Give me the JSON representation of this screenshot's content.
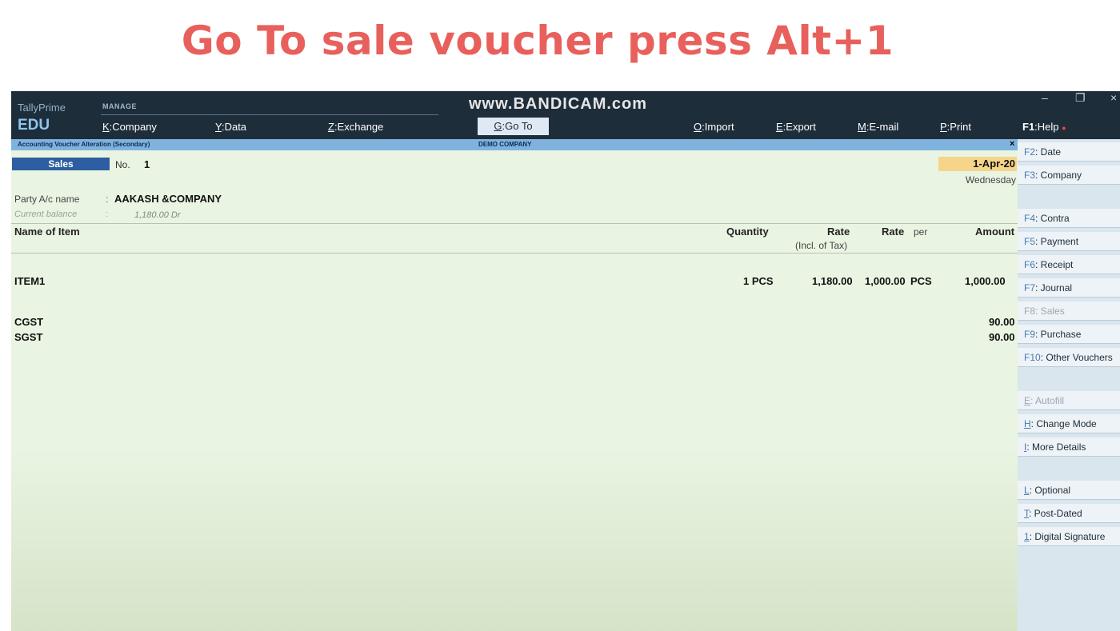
{
  "caption": "Go To sale voucher press Alt+1",
  "app": {
    "product": "TallyPrime",
    "edition": "EDU",
    "manage_label": "MANAGE",
    "watermark": "www.BANDICAM.com",
    "menu": [
      {
        "key": "K",
        "label": ":Company"
      },
      {
        "key": "Y",
        "label": ":Data"
      },
      {
        "key": "Z",
        "label": ":Exchange"
      },
      {
        "key": "G",
        "label": ":Go To"
      },
      {
        "key": "O",
        "label": ":Import"
      },
      {
        "key": "E",
        "label": ":Export"
      },
      {
        "key": "M",
        "label": ":E-mail"
      },
      {
        "key": "P",
        "label": ":Print"
      },
      {
        "key": "F1",
        "label": ":Help"
      }
    ],
    "window_controls": {
      "minimize": "–",
      "restore": "❐",
      "close": "×"
    }
  },
  "title_strip": {
    "left": "Accounting Voucher Alteration (Secondary)",
    "center": "DEMO COMPANY",
    "close": "×"
  },
  "voucher": {
    "type": "Sales",
    "no_label": "No.",
    "no_value": "1",
    "date": "1-Apr-20",
    "day": "Wednesday",
    "party_label": "Party A/c name",
    "party_colon": ":",
    "party_value": "AAKASH &COMPANY",
    "balance_label": "Current balance",
    "balance_colon": ":",
    "balance_value": "1,180.00 Dr"
  },
  "columns": {
    "name": "Name of Item",
    "quantity": "Quantity",
    "rate_incl": "Rate",
    "rate_incl_sub": "(Incl. of Tax)",
    "rate": "Rate",
    "per": "per",
    "amount": "Amount"
  },
  "items": [
    {
      "name": "ITEM1",
      "quantity": "1 PCS",
      "rate_incl": "1,180.00",
      "rate": "1,000.00",
      "per": "PCS",
      "amount": "1,000.00"
    }
  ],
  "taxes": [
    {
      "name": "CGST",
      "amount": "90.00"
    },
    {
      "name": "SGST",
      "amount": "90.00"
    }
  ],
  "sidebar": [
    {
      "key": "F2",
      "label": ": Date",
      "enabled": true
    },
    {
      "key": "F3",
      "label": ": Company",
      "enabled": true
    },
    {
      "key": "F4",
      "label": ": Contra",
      "enabled": true
    },
    {
      "key": "F5",
      "label": ": Payment",
      "enabled": true
    },
    {
      "key": "F6",
      "label": ": Receipt",
      "enabled": true
    },
    {
      "key": "F7",
      "label": ": Journal",
      "enabled": true
    },
    {
      "key": "F8",
      "label": ": Sales",
      "enabled": false
    },
    {
      "key": "F9",
      "label": ": Purchase",
      "enabled": true
    },
    {
      "key": "F10",
      "label": ": Other Vouchers",
      "enabled": true
    },
    {
      "key": "E",
      "label": ": Autofill",
      "enabled": false
    },
    {
      "key": "H",
      "label": ": Change Mode",
      "enabled": true
    },
    {
      "key": "I",
      "label": ": More Details",
      "enabled": true
    },
    {
      "key": "L",
      "label": ": Optional",
      "enabled": true
    },
    {
      "key": "T",
      "label": ": Post-Dated",
      "enabled": true
    },
    {
      "key": "1",
      "label": ": Digital Signature",
      "enabled": true
    }
  ]
}
